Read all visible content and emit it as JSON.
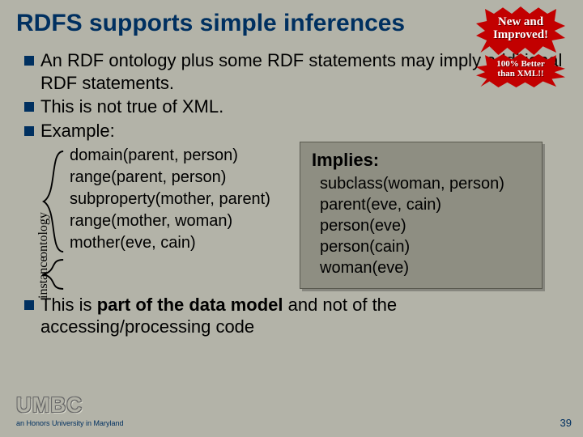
{
  "title": "RDFS supports simple inferences",
  "burst1_l1": "New and",
  "burst1_l2": "Improved!",
  "burst2_l1": "100% Better",
  "burst2_l2": "than XML!!",
  "bullets": {
    "b1": "An RDF ontology plus some RDF statements may imply additional RDF statements.",
    "b2": "This is not true of XML.",
    "b3": "Example:",
    "b4_pre": "This is ",
    "b4_bold": "part of the data model",
    "b4_post": " and not of the accessing/processing code"
  },
  "ontology_label": "ontology",
  "instance_label": "instance",
  "ontology_lines": [
    "domain(parent, person)",
    "range(parent, person)",
    "subproperty(mother, parent)",
    "range(mother, woman)"
  ],
  "instance_lines": [
    "mother(eve, cain)"
  ],
  "implies_title": "Implies:",
  "implies_lines": [
    "subclass(woman, person)",
    "parent(eve, cain)",
    "person(eve)",
    "person(cain)",
    "woman(eve)"
  ],
  "footer": {
    "umbc": "UMBC",
    "tagline": "an Honors University in Maryland",
    "pagenum": "39"
  }
}
